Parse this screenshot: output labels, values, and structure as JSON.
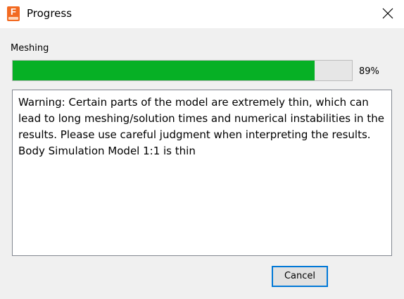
{
  "window": {
    "title": "Progress",
    "app_icon_letter": "F",
    "accent_color": "#f26a21"
  },
  "progress": {
    "label": "Meshing",
    "percent_value": 89,
    "percent_text": "89%",
    "fill_color": "#06b025"
  },
  "messages": {
    "warning": "Warning: Certain parts of the model are extremely thin, which can lead to long meshing/solution times and numerical instabilities in the results. Please use careful judgment when interpreting the results.",
    "detail": "Body Simulation Model 1:1 is thin"
  },
  "buttons": {
    "cancel_label": "Cancel"
  }
}
